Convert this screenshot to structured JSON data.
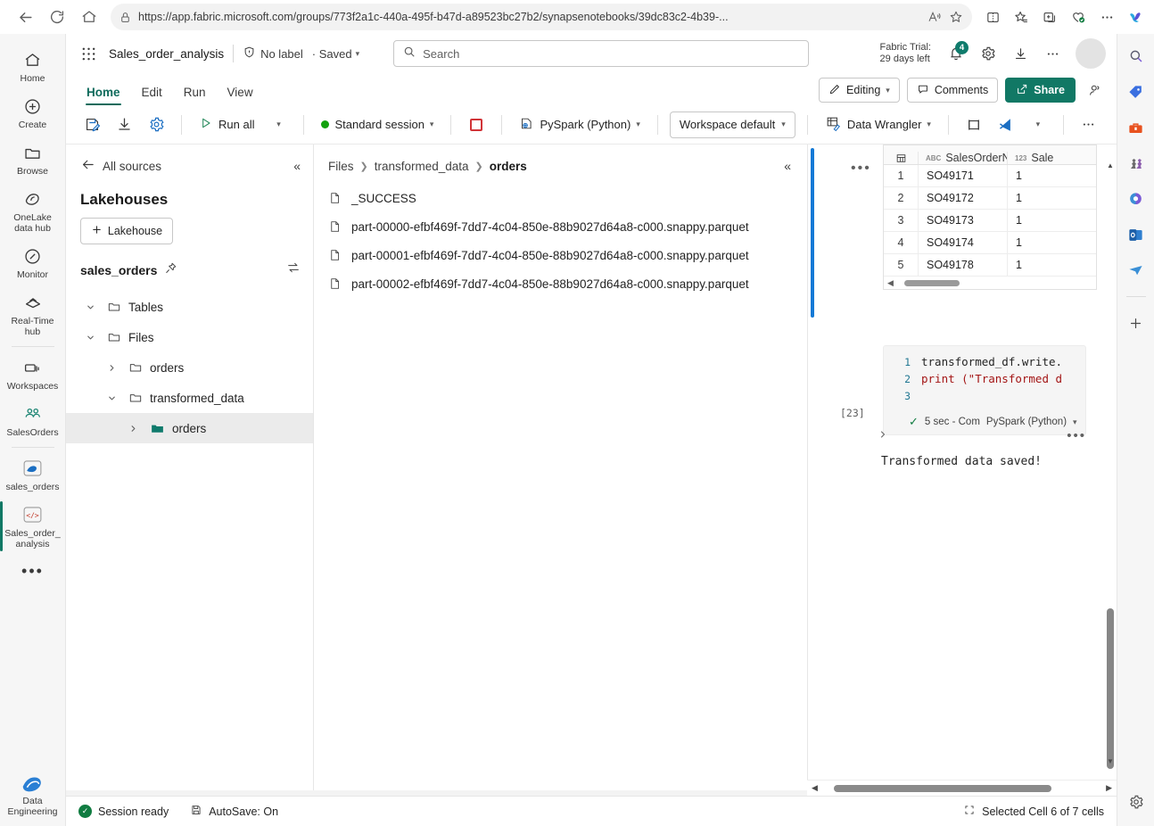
{
  "browser": {
    "url": "https://app.fabric.microsoft.com/groups/773f2a1c-440a-495f-b47d-a89523bc27b2/synapsenotebooks/39dc83c2-4b39-...",
    "back_icon": "back-arrow-icon",
    "refresh_icon": "refresh-icon",
    "home_icon": "home-icon",
    "lock_icon": "lock-icon",
    "read_aloud_icon": "read-aloud-icon",
    "favorite_icon": "star-icon",
    "split_icon": "split-screen-icon",
    "collections_icon": "collections-icon",
    "browser_essentials_icon": "browser-essentials-icon",
    "settings_more_icon": "more-icon",
    "copilot_icon": "copilot-icon"
  },
  "rail": {
    "items": [
      {
        "label": "Home",
        "icon": "home-icon"
      },
      {
        "label": "Create",
        "icon": "plus-circle-icon"
      },
      {
        "label": "Browse",
        "icon": "folder-icon"
      },
      {
        "label": "OneLake\ndata hub",
        "icon": "onelake-icon"
      },
      {
        "label": "Monitor",
        "icon": "monitor-icon"
      },
      {
        "label": "Real-Time\nhub",
        "icon": "realtime-hub-icon"
      },
      {
        "label": "Workspaces",
        "icon": "workspaces-icon"
      },
      {
        "label": "SalesOrders",
        "icon": "people-icon"
      },
      {
        "label": "sales_orders",
        "icon": "lakehouse-icon"
      },
      {
        "label": "Sales_order_\nanalysis",
        "icon": "notebook-icon"
      }
    ],
    "more": "•••",
    "bottom_label": "Data\nEngineering",
    "bottom_icon": "data-engineering-icon"
  },
  "header": {
    "waffle_icon": "app-launcher-icon",
    "doc_title": "Sales_order_analysis",
    "sensitivity_icon": "shield-icon",
    "sensitivity_label": "No label",
    "saved_label": "· Saved",
    "saved_chevron": "⌄",
    "search_placeholder": "Search",
    "search_icon": "search-icon",
    "trial_line1": "Fabric Trial:",
    "trial_line2": "29 days left",
    "notification_icon": "bell-icon",
    "notification_count": "4",
    "settings_icon": "gear-icon",
    "download_icon": "download-icon",
    "more_icon": "more-icon",
    "avatar": "avatar"
  },
  "ribbon_tabs": {
    "tabs": [
      {
        "label": "Home",
        "active": true
      },
      {
        "label": "Edit",
        "active": false
      },
      {
        "label": "Run",
        "active": false
      },
      {
        "label": "View",
        "active": false
      }
    ],
    "editing_label": "Editing",
    "editing_icon": "pencil-icon",
    "comments_label": "Comments",
    "comments_icon": "comment-icon",
    "share_label": "Share",
    "share_icon": "share-icon",
    "people_icon": "people-add-icon"
  },
  "toolbar": {
    "save_icon": "save-edit-icon",
    "download_icon": "download-icon",
    "settings_icon": "gear-icon",
    "run_all_label": "Run all",
    "run_all_icon": "play-icon",
    "session_label": "Standard session",
    "session_dot_color": "#13a10e",
    "stop_icon": "stop-icon",
    "language_label": "PySpark (Python)",
    "language_icon": "python-icon",
    "environment_label": "Workspace default",
    "data_wrangler_label": "Data Wrangler",
    "data_wrangler_icon": "data-wrangler-icon",
    "layout_icon": "layout-icon",
    "vscode_icon": "vscode-icon",
    "more_icon": "more-icon"
  },
  "explorer": {
    "back_label": "All sources",
    "back_icon": "back-arrow-icon",
    "collapse_icon": "chevron-double-left-icon",
    "heading": "Lakehouses",
    "add_lakehouse_label": "Lakehouse",
    "add_icon": "plus-icon",
    "lakehouse_name": "sales_orders",
    "pin_icon": "pin-icon",
    "sync_icon": "swap-icon",
    "tree": [
      {
        "label": "Tables",
        "level": 0,
        "expanded": true,
        "icon": "folder-icon",
        "selected": false
      },
      {
        "label": "Files",
        "level": 0,
        "expanded": true,
        "icon": "folder-icon",
        "selected": false
      },
      {
        "label": "orders",
        "level": 1,
        "expanded": false,
        "icon": "folder-icon",
        "selected": false
      },
      {
        "label": "transformed_data",
        "level": 1,
        "expanded": true,
        "icon": "folder-icon",
        "selected": false
      },
      {
        "label": "orders",
        "level": 2,
        "expanded": false,
        "icon": "folder-filled-icon",
        "selected": true
      }
    ]
  },
  "files_pane": {
    "breadcrumb": [
      "Files",
      "transformed_data",
      "orders"
    ],
    "collapse_icon": "chevron-double-left-icon",
    "files": [
      "_SUCCESS",
      "part-00000-efbf469f-7dd7-4c04-850e-88b9027d64a8-c000.snappy.parquet",
      "part-00001-efbf469f-7dd7-4c04-850e-88b9027d64a8-c000.snappy.parquet",
      "part-00002-efbf469f-7dd7-4c04-850e-88b9027d64a8-c000.snappy.parquet"
    ],
    "file_icon": "document-icon"
  },
  "notebook": {
    "cell_more_icon": "•••",
    "grid": {
      "table_icon": "table-icon",
      "columns": [
        {
          "type_tag": "ABC",
          "name": "SalesOrderNumber"
        },
        {
          "type_tag": "123",
          "name": "Sale"
        }
      ],
      "rows": [
        {
          "idx": "1",
          "c1": "SO49171",
          "c2": "1"
        },
        {
          "idx": "2",
          "c1": "SO49172",
          "c2": "1"
        },
        {
          "idx": "3",
          "c1": "SO49173",
          "c2": "1"
        },
        {
          "idx": "4",
          "c1": "SO49174",
          "c2": "1"
        },
        {
          "idx": "5",
          "c1": "SO49178",
          "c2": "1"
        }
      ]
    },
    "code": {
      "lines": [
        {
          "no": "1",
          "text": "transformed_df.write."
        },
        {
          "no": "2",
          "text": "print (\"Transformed d"
        },
        {
          "no": "3",
          "text": ""
        }
      ],
      "exec_index": "[23]",
      "status_check": "✓",
      "status_text": "5 sec - Com",
      "status_lang": "PySpark (Python)"
    },
    "output": {
      "expand_icon": "chevron-right-icon",
      "more_icon": "•••",
      "text": "Transformed data saved!"
    }
  },
  "statusbar": {
    "session_label": "Session ready",
    "session_icon": "check-circle-icon",
    "autosave_label": "AutoSave: On",
    "autosave_icon": "save-icon",
    "selection_label": "Selected Cell 6 of 7 cells",
    "selection_icon": "cell-select-icon",
    "settings_icon": "gear-icon"
  },
  "edge_sidebar": {
    "items": [
      {
        "icon": "search-icon"
      },
      {
        "icon": "shopping-tag-icon"
      },
      {
        "icon": "tools-icon"
      },
      {
        "icon": "games-icon"
      },
      {
        "icon": "microsoft-365-icon"
      },
      {
        "icon": "outlook-icon"
      },
      {
        "icon": "send-icon"
      }
    ],
    "add_icon": "plus-icon",
    "bottom_icon": "gear-icon"
  },
  "colors": {
    "brand_green": "#117865",
    "accent_blue": "#1379d6",
    "session_green": "#13a10e",
    "stop_red": "#d13438"
  }
}
